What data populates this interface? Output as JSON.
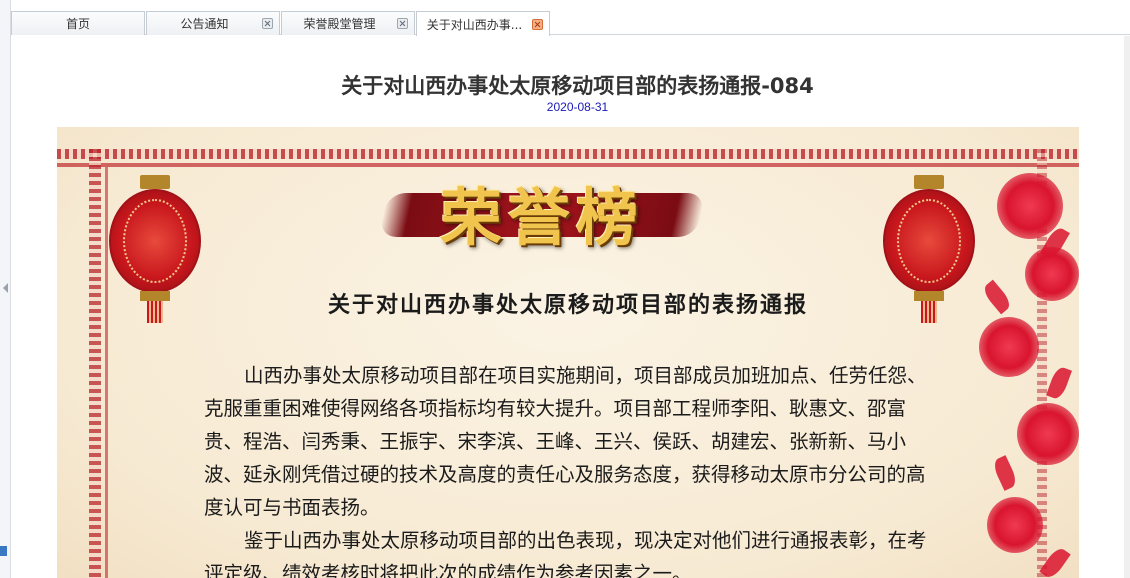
{
  "tabs": [
    {
      "label": "首页",
      "closable": false,
      "active": false
    },
    {
      "label": "公告通知",
      "closable": true,
      "active": false
    },
    {
      "label": "荣誉殿堂管理",
      "closable": true,
      "active": false
    },
    {
      "label": "关于对山西办事...",
      "closable": true,
      "active": true
    }
  ],
  "article": {
    "title": "关于对山西办事处太原移动项目部的表扬通报-084",
    "date": "2020-08-31"
  },
  "certificate": {
    "banner": "荣誉榜",
    "heading": "关于对山西办事处太原移动项目部的表扬通报",
    "paragraph1": "山西办事处太原移动项目部在项目实施期间，项目部成员加班加点、任劳任怨、克服重重困难使得网络各项指标均有较大提升。项目部工程师李阳、耿惠文、邵富贵、程浩、闫秀秉、王振宇、宋李滨、王峰、王兴、侯跃、胡建宏、张新新、马小波、延永刚凭借过硬的技术及高度的责任心及服务态度，获得移动太原市分公司的高度认可与书面表扬。",
    "paragraph2": "鉴于山西办事处太原移动项目部的出色表现，现决定对他们进行通报表彰，在考评定级、绩效考核时将把此次的成绩作为参考因素之一。"
  },
  "colors": {
    "title": "#333333",
    "date": "#1a1ab8",
    "accent_red": "#c8171d",
    "gold": "#f1c44d"
  },
  "icons": {
    "tab_close": "close-icon",
    "left_collapse": "collapse-arrow-icon"
  }
}
